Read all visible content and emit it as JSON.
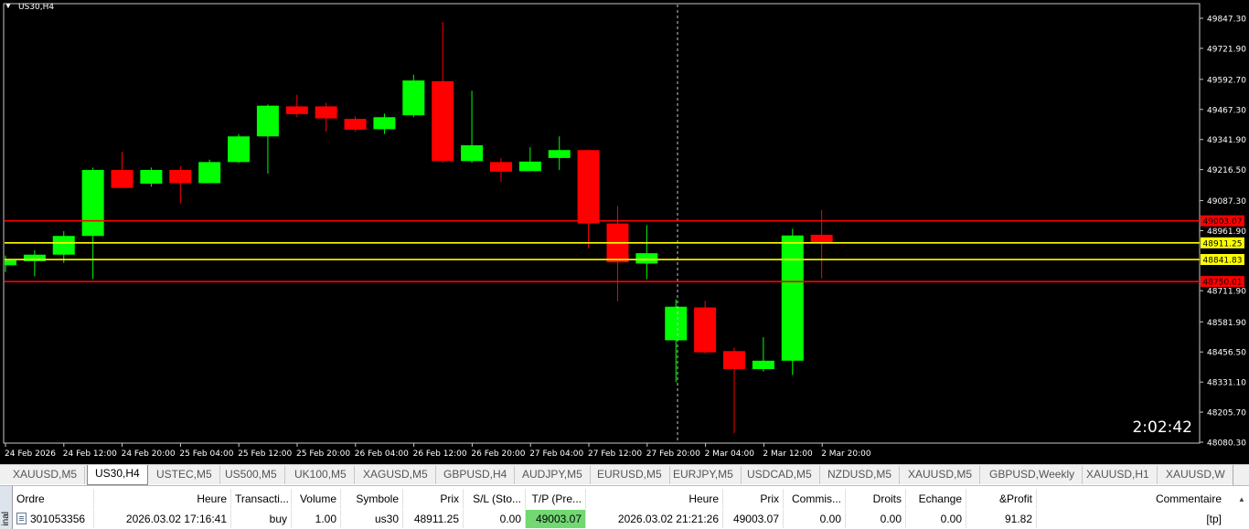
{
  "window": {
    "symbol_title": "US30,H4",
    "countdown": "2:02:42"
  },
  "chart_data": {
    "type": "candlestick",
    "symbol": "US30",
    "timeframe": "H4",
    "ylim": [
      48080.3,
      49920
    ],
    "y_ticks": [
      "49847.30",
      "49721.90",
      "49592.70",
      "49467.30",
      "49341.90",
      "49216.50",
      "49087.30",
      "48961.90",
      "48711.90",
      "48581.90",
      "48456.50",
      "48331.10",
      "48205.70",
      "48080.30"
    ],
    "x_labels": [
      "24 Feb 2026",
      "24 Feb 12:00",
      "24 Feb 20:00",
      "25 Feb 04:00",
      "25 Feb 12:00",
      "25 Feb 20:00",
      "26 Feb 04:00",
      "26 Feb 12:00",
      "26 Feb 20:00",
      "27 Feb 04:00",
      "27 Feb 12:00",
      "27 Feb 20:00",
      "2 Mar 04:00",
      "2 Mar 12:00",
      "2 Mar 20:00"
    ],
    "candles": [
      {
        "o": 48818,
        "h": 48858,
        "l": 48790,
        "c": 48838
      },
      {
        "o": 48835,
        "h": 48880,
        "l": 48772,
        "c": 48862
      },
      {
        "o": 48862,
        "h": 48960,
        "l": 48828,
        "c": 48940
      },
      {
        "o": 48940,
        "h": 49225,
        "l": 48760,
        "c": 49215
      },
      {
        "o": 49215,
        "h": 49290,
        "l": 49142,
        "c": 49140
      },
      {
        "o": 49158,
        "h": 49225,
        "l": 49145,
        "c": 49215
      },
      {
        "o": 49215,
        "h": 49230,
        "l": 49075,
        "c": 49160
      },
      {
        "o": 49160,
        "h": 49258,
        "l": 49160,
        "c": 49248
      },
      {
        "o": 49248,
        "h": 49365,
        "l": 49245,
        "c": 49355
      },
      {
        "o": 49355,
        "h": 49488,
        "l": 49200,
        "c": 49483
      },
      {
        "o": 49480,
        "h": 49528,
        "l": 49435,
        "c": 49448
      },
      {
        "o": 49480,
        "h": 49495,
        "l": 49375,
        "c": 49430
      },
      {
        "o": 49428,
        "h": 49438,
        "l": 49375,
        "c": 49383
      },
      {
        "o": 49385,
        "h": 49450,
        "l": 49365,
        "c": 49435
      },
      {
        "o": 49443,
        "h": 49612,
        "l": 49435,
        "c": 49588
      },
      {
        "o": 49585,
        "h": 49832,
        "l": 49245,
        "c": 49252
      },
      {
        "o": 49252,
        "h": 49545,
        "l": 49245,
        "c": 49318
      },
      {
        "o": 49248,
        "h": 49265,
        "l": 49165,
        "c": 49208
      },
      {
        "o": 49210,
        "h": 49310,
        "l": 49210,
        "c": 49250
      },
      {
        "o": 49265,
        "h": 49355,
        "l": 49215,
        "c": 49298
      },
      {
        "o": 49298,
        "h": 49298,
        "l": 48888,
        "c": 48992
      },
      {
        "o": 48992,
        "h": 49065,
        "l": 48668,
        "c": 48830
      },
      {
        "o": 48825,
        "h": 48985,
        "l": 48760,
        "c": 48868
      },
      {
        "o": 48505,
        "h": 48675,
        "l": 48330,
        "c": 48645
      },
      {
        "o": 48642,
        "h": 48670,
        "l": 48450,
        "c": 48455
      },
      {
        "o": 48460,
        "h": 48475,
        "l": 48118,
        "c": 48385
      },
      {
        "o": 48385,
        "h": 48518,
        "l": 48375,
        "c": 48420
      },
      {
        "o": 48420,
        "h": 48970,
        "l": 48360,
        "c": 48942
      },
      {
        "o": 48945,
        "h": 49048,
        "l": 48763,
        "c": 48910
      }
    ],
    "levels": [
      {
        "price": 49003.07,
        "label": "49003.07",
        "color": "#ff0000"
      },
      {
        "price": 48911.25,
        "label": "48911.25",
        "color": "#ffff00"
      },
      {
        "price": 48841.83,
        "label": "48841.83",
        "color": "#ffff00"
      },
      {
        "price": 48750.01,
        "label": "48750.01",
        "color": "#ff0000"
      }
    ],
    "bull_color": "#00ff00",
    "bear_color": "#ff0000",
    "grid": false
  },
  "tabs": [
    "XAUUSD,M5",
    "US30,H4",
    "USTEC,M5",
    "US500,M5",
    "UK100,M5",
    "XAGUSD,M5",
    "GBPUSD,H4",
    "AUDJPY,M5",
    "EURUSD,M5",
    "EURJPY,M5",
    "USDCAD,M5",
    "NZDUSD,M5",
    "XAUUSD,M5",
    "GBPUSD,Weekly",
    "XAUUSD,H1",
    "XAUUSD,W"
  ],
  "active_tab": "US30,H4",
  "terminal": {
    "side_label": "inal",
    "headers": [
      "Ordre",
      "Heure",
      "Transacti...",
      "Volume",
      "Symbole",
      "Prix",
      "S/L (Sto...",
      "T/P (Pre...",
      "Heure",
      "Prix",
      "Commis...",
      "Droits",
      "Echange",
      "&Profit",
      "Commentaire"
    ],
    "row": {
      "order": "301053356",
      "open_time": "2026.03.02 17:16:41",
      "type": "buy",
      "volume": "1.00",
      "symbol": "us30",
      "open_price": "48911.25",
      "sl": "0.00",
      "tp": "49003.07",
      "time": "2026.03.02 21:21:26",
      "price": "49003.07",
      "commission": "0.00",
      "swap_fees": "0.00",
      "swap": "0.00",
      "profit": "91.82",
      "comment": "[tp]"
    }
  }
}
